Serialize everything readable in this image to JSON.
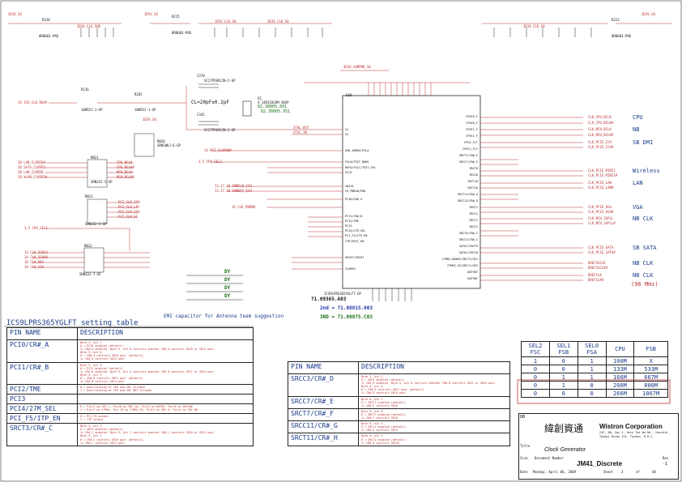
{
  "top_labels": {
    "rails": [
      "3D3V_S0",
      "1D5V_S0",
      "3D3V_S0"
    ],
    "refs": [
      "R220",
      "R215",
      "R222"
    ],
    "beads": [
      "0R0603-PAD",
      "0R0603-PAD",
      "0R0603-PAD"
    ],
    "nets": [
      "3D3V_CLK_SUB",
      "1D5V_CLK_S0",
      "3D3V_CLK_S0",
      "3D3V_CLK_S0"
    ]
  },
  "left_nets": {
    "ich_clk": "14 ICH_CLK_REQ#",
    "r216": "R216",
    "r216_val": "10KR2J-1-GP",
    "r265": "R265",
    "r265_val": "10KR2J-1-GP",
    "rn20": "RN20",
    "rn20_val": "SRN10KJ-6-GP",
    "vcc": "3D3V_S0",
    "rn21": "RN21",
    "rn21_val": "SRN33J-5-GP",
    "rn21_nets": [
      "CPU_BCLK",
      "CPU_BCLK#",
      "MCH_BCLK",
      "MCH_BCLK#"
    ],
    "clk_list_a": [
      "20 LAN_CLKREQ#",
      "20 SATA_CLKREQ",
      "20 LAN_CLKREQ",
      "20 WLAN_CLKREQ#"
    ],
    "rn11": "RN11",
    "rn11_val": "SRN33J-5-GP",
    "rn11_nets": [
      "PCI_CLK_ICH",
      "PCI_CLK_LPC",
      "PCI_CLK_SIO",
      "PCI_CLK_EC"
    ],
    "rn12": "RN12",
    "rn12_val": "SRN33J-7-GP",
    "rn12_nets": [
      "14 CLK_ICH14",
      "14 CLK_ICH48",
      "18 CLK_KBC",
      "18 CLK_SIO"
    ],
    "cpu_sel1": "3,5 CPU_SEL1",
    "cpu_sel2": "3,5 CPU_SEL2",
    "pci_clk_pm": "14 PCI_CLKRUN#",
    "x_pm": "14 CLK_PWRDN",
    "smb": [
      "13,17,18 SMBCLK_ICH",
      "13,17,18 SMBDAT_ICH"
    ]
  },
  "crystal": {
    "caps": [
      "C370",
      "C342"
    ],
    "cap_val": "SC27P50V2JN-2-GP",
    "note": "CL=20pF±0.2pF",
    "ref": "X2",
    "part": "X-14D31818M-38GP",
    "pn1": "82.30005.891",
    "pn2": "82.30005.951",
    "nets": [
      "XTAL_OUT",
      "XTAL_IN"
    ]
  },
  "ic": {
    "ref": "U38",
    "part_top": "3D3V_48MPWR_S0",
    "part": "ICS9LPRS365YGLFT-GP",
    "pn": "71.09365.A03",
    "second": "2nd = 71.08815.003",
    "third": "3RD = 71.00875.C03",
    "right_pins": [
      "CPUT0_F",
      "CPUC0_F",
      "CPUT1_F",
      "CPUC1_F",
      "CPU2_FLT",
      "CPUC2_FLT",
      "SRCT7/CR#_E",
      "SRCC7/CR#_E",
      "SRCT8",
      "SRCC8",
      "SRCT10",
      "SRCC10",
      "SRCT11/CR#_G",
      "SRCC11/CR#_G",
      "SRCT1",
      "SRCC1",
      "SRCT2",
      "SRCC2",
      "SRCT3/CR#_C",
      "SRCC3/CR#_C",
      "SATAT/SRCT0",
      "SATAC/SRCC0",
      "27MHZ_NONSS/SRCT1/SE1",
      "27MHZ_SS/SRCC1/SE2",
      "DOT96T",
      "DOT96C"
    ],
    "left_pins": [
      "X1",
      "X2",
      "USB_48MHZ/FSLA",
      "FSLB/TEST_MODE",
      "REF0/FSLC/TEST_SEL",
      "SCLK",
      "SDATA",
      "CK_PWRGD/PD#",
      "PCI0/CR#_A",
      "PCI1/CR#_B",
      "PCI2/TME",
      "PCI3",
      "PCI4/27M_SEL",
      "PCI_F5/ITP_EN",
      "ITP/SRCT_EN",
      "SRC6T/SRC0T",
      "CLKREQ"
    ]
  },
  "right_nets": [
    {
      "net": "CLK_CPU_BCLK",
      "dest": "CPU"
    },
    {
      "net": "CLK_CPU_BCLK#",
      "dest": ""
    },
    {
      "net": "CLK_MCH_BCLK",
      "dest": "NB"
    },
    {
      "net": "CLK_MCH_BCLK#",
      "dest": ""
    },
    {
      "net": "CLK_PCIE_ICH",
      "dest": "SB DMI"
    },
    {
      "net": "CLK_PCIE_ICH#",
      "dest": ""
    },
    {
      "net": "CLK_PCIE_MINI1",
      "dest": "Wireless"
    },
    {
      "net": "CLK_PCIE_MINI1#",
      "dest": ""
    },
    {
      "net": "CLK_PCIE_LAN",
      "dest": "LAN"
    },
    {
      "net": "CLK_PCIE_LAN#",
      "dest": ""
    },
    {
      "net": "CLK_PCIE_VGA",
      "dest": "VGA"
    },
    {
      "net": "CLK_PCIE_VGA#",
      "dest": ""
    },
    {
      "net": "CLK_MCH_3GPLL",
      "dest": "NB CLK"
    },
    {
      "net": "CLK_MCH_3GPLL#",
      "dest": ""
    },
    {
      "net": "CLK_PCIE_SATA",
      "dest": "SB SATA"
    },
    {
      "net": "CLK_PCIE_SATA#",
      "dest": ""
    },
    {
      "net": "DREFSSCLK",
      "dest": "NB CLK"
    },
    {
      "net": "DREFSSCLK#",
      "dest": ""
    },
    {
      "net": "DREFCLK",
      "dest": "NB CLK"
    },
    {
      "net": "DREFCLK#",
      "dest": "(96 MHz)"
    }
  ],
  "emi_caps": [
    "DY",
    "DY",
    "DY",
    "DY"
  ],
  "emi_note": "EMI capacitor for Antenna team suggestion",
  "setting_title": "ICS9LPRS365YGLFT setting table",
  "pin_table": {
    "headers": [
      "PIN NAME",
      "DESCRIPTION"
    ],
    "rows": [
      {
        "name": "PCI0/CR#_A",
        "desc": "Byte 5, bit 7\n0 = PCI0 enabled (default)\n1= CR#_A enabled. Byte 5, bit 6 controls whether CR#_A controls SRC0 or SRC2 pair\nByte 5, bit 6\n0 = CR#_A controls SRC0 pair (default),\n1= CR#_A controls SRC2 pair"
      },
      {
        "name": "PCI1/CR#_B",
        "desc": "Byte 5, bit 5\n0 = PCI1 enabled (default)\n1= CR#_B enabled. Byte 5, bit 4 controls whether CR#_B controls SRC1 or SRC4 pair\nByte 5, bit 4\n0 = CR#_B controls SRC1 pair (default)\n1= CR#_B controls SRC4 pair"
      },
      {
        "name": "PCI2/TME",
        "desc": "0 = Overclocking of CPU and SRC Allowed\n1 = Overclocking of CPU and SRC NOT allowed"
      },
      {
        "name": "PCI3",
        "desc": ""
      },
      {
        "name": "PCI4/27M_SEL",
        "desc": "0 = Pin17 as SRC-1, Pin18 as SRC-1#, Pin13 as DOT96, Pin14 as DOT96#\n1 = Pin17 as 27MHz, Pin 18 as 27MHz_SS, Pin13 as SRC-0, Pin14 as SRC-0#"
      },
      {
        "name": "PCI_F5/ITP_EN",
        "desc": "0 = PCI_F5 output\n1 = ITP output"
      },
      {
        "name": "SRCT3/CR#_C",
        "desc": "Byte 5, bit 3\n0 = SRC3 enabled (default)\n1= CR#_C enabled. Byte 5, bit 2 controls whether CR#_C controls SRC0 or SRC2 pair\nByte 5, bit 2\n0 = CR#_C controls SRC0 pair (default),\n1= CR#_C controls SRC2 pair"
      }
    ]
  },
  "pin_table2": {
    "headers": [
      "PIN NAME",
      "DESCRIPTION"
    ],
    "rows": [
      {
        "name": "SRCC3/CR#_D",
        "desc": "Byte 5, bit 1\n0 = SRC3 enabled (default)\n1= CR#_D enabled. Byte 5, bit 0 controls whether CR#_D controls SRC1 or SRC4 pair\nByte 5, bit 0\n0 = CR#_D controls SRC1 pair (default)\n1= CR#_D controls SRC4 pair"
      },
      {
        "name": "SRCC7/CR#_E",
        "desc": "Byte 6, bit 7\n0 = SRCC7 enabled (default)\n1= CR#_E controls SRC6"
      },
      {
        "name": "SRCT7/CR#_F",
        "desc": "Byte 6, bit 6\n0 = SRCT7 enabled (default)\n1= CR#_F controls SRC8"
      },
      {
        "name": "SRCC11/CR#_G",
        "desc": "Byte 6, bit 5\n0 = SRC11 enabled (default)\n1= CR#_G controls SRC9"
      },
      {
        "name": "SRCT11/CR#_H",
        "desc": "Byte 6, bit 4\n0 = SRC11 enabled (default)\n1= CR#_H controls SRC10"
      }
    ]
  },
  "fs_table": {
    "headers": [
      [
        "SEL2",
        "FSC"
      ],
      [
        "SEL1",
        "FSB"
      ],
      [
        "SEL0",
        "FSA"
      ],
      [
        "CPU",
        ""
      ],
      [
        "FSB",
        ""
      ]
    ],
    "rows": [
      [
        "1",
        "0",
        "1",
        "100M",
        "X"
      ],
      [
        "0",
        "0",
        "1",
        "133M",
        "533M"
      ],
      [
        "0",
        "1",
        "1",
        "166M",
        "667M"
      ],
      [
        "0",
        "1",
        "0",
        "200M",
        "800M"
      ],
      [
        "0",
        "0",
        "0",
        "266M",
        "1067M"
      ]
    ]
  },
  "title_block": {
    "company_cn": "緯創資通",
    "company": "Wistron Corporation",
    "address1": "21F, 88, Sec.1, Hsin Tai Wu Rd., Hsichih,",
    "address2": "Taipei Hsien 221, Taiwan, R.O.C.",
    "title_label": "Title",
    "title": "Clock Generator",
    "size_label": "Size",
    "doc_label": "Document Number",
    "rev_label": "Rev",
    "doc": "JM41_Discrete",
    "rev": "-1",
    "date_label": "Date",
    "date": "Monday, April 06, 2009",
    "sheet_label": "Sheet",
    "sheet": "3",
    "of": "of",
    "total": "48",
    "code": "DB"
  }
}
